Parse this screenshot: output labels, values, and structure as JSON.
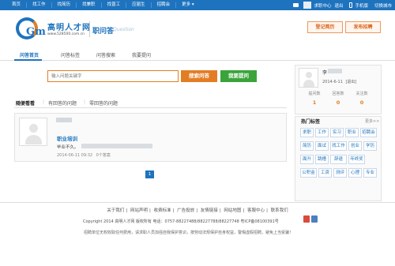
{
  "topbar": {
    "nav": [
      "首页",
      "找工作",
      "找简历",
      "找兼职",
      "找普工",
      "应届生",
      "招聘会",
      "更多"
    ],
    "user_links": [
      "求职中心",
      "退出"
    ],
    "phone_label": "手机版",
    "switch_city": "切换城市"
  },
  "header": {
    "logo_mark": "Gm",
    "logo_title": "高明人才网",
    "logo_url": "www.528500.com.cn",
    "section_title": "职问答",
    "section_sub": "Question",
    "btn_register_resume": "登记简历",
    "btn_post_job": "发布招聘"
  },
  "subnav": {
    "items": [
      "问答首页",
      "问答标签",
      "问答搜索",
      "我要提问"
    ]
  },
  "search": {
    "placeholder": "输入问题关键字",
    "btn_search": "搜索问答",
    "btn_ask": "我要提问"
  },
  "question_tabs": {
    "items": [
      "随便看看",
      "有回答的问题",
      "零回答的问题"
    ],
    "separator": "|"
  },
  "question": {
    "title": "职业培训",
    "body": "毕业不久。",
    "time": "2014-06-11 09:32",
    "answers": "0个答案"
  },
  "pagination": {
    "current": "1"
  },
  "user_panel": {
    "name": "李",
    "time": "2014-6-11",
    "logout": "[退出]",
    "stats": [
      {
        "label": "提问数",
        "value": "1"
      },
      {
        "label": "回答数",
        "value": "0"
      },
      {
        "label": "关注数",
        "value": "0"
      }
    ]
  },
  "hot_tags": {
    "title": "热门标签",
    "more": "更多>>",
    "tags": [
      "求职",
      "工作",
      "实习",
      "职业",
      "招聘会",
      "简历",
      "面试",
      "找工作",
      "创业",
      "学历",
      "面升",
      "跳槽",
      "辞退",
      "年终奖",
      "公积金",
      "工资",
      "测评",
      "心理",
      "专业"
    ]
  },
  "footer": {
    "links": [
      "关于我们",
      "网站声明",
      "收费标准",
      "广告投放",
      "友情链接",
      "网站地图",
      "客服中心",
      "联系我们"
    ],
    "copyright": "Copyright 2014 高明人才网 版权所有 电话：0757-88227488/88227788/88227748 粤ICP备08100391号",
    "notice": "招聘单位无权收取任何费用，请求职人员加强自我保护意识，按劳动法规保护自身权益，警惕虚假招聘，避免上当受骗！"
  },
  "colors": {
    "primary": "#1e73be",
    "accent": "#e37d24",
    "green": "#3aa43a"
  }
}
